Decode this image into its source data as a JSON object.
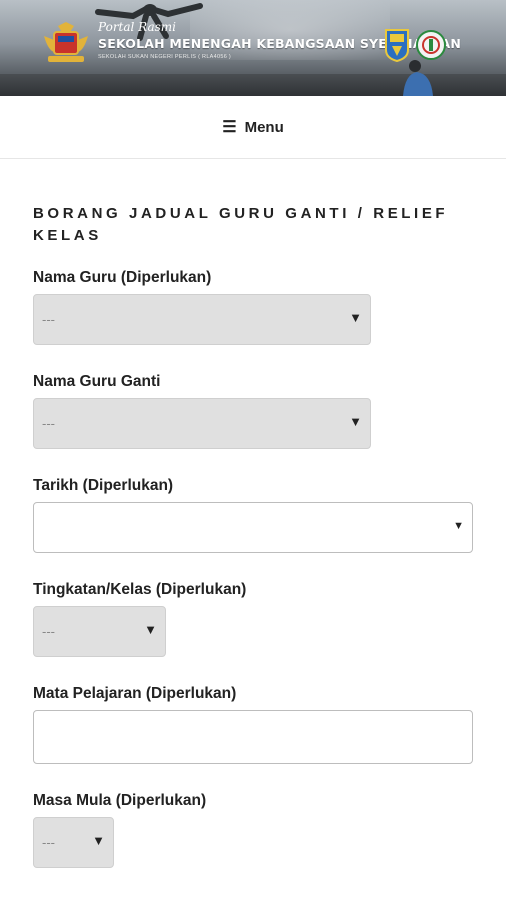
{
  "header": {
    "portal_text": "Portal Rasmi",
    "school_name": "SEKOLAH MENENGAH KEBANGSAAN SYED HASSAN",
    "school_subtitle": "SEKOLAH SUKAN NEGERI PERLIS ( RLA4056 )",
    "menu_label": "Menu"
  },
  "form": {
    "title": "BORANG JADUAL GURU GANTI / RELIEF KELAS",
    "fields": [
      {
        "label": "Nama Guru (Diperlukan)",
        "value": "---"
      },
      {
        "label": "Nama Guru Ganti",
        "value": "---"
      },
      {
        "label": "Tarikh (Diperlukan)",
        "value": ""
      },
      {
        "label": "Tingkatan/Kelas (Diperlukan)",
        "value": "---"
      },
      {
        "label": "Mata Pelajaran (Diperlukan)",
        "value": ""
      },
      {
        "label": "Masa Mula (Diperlukan)",
        "value": "---"
      }
    ]
  }
}
